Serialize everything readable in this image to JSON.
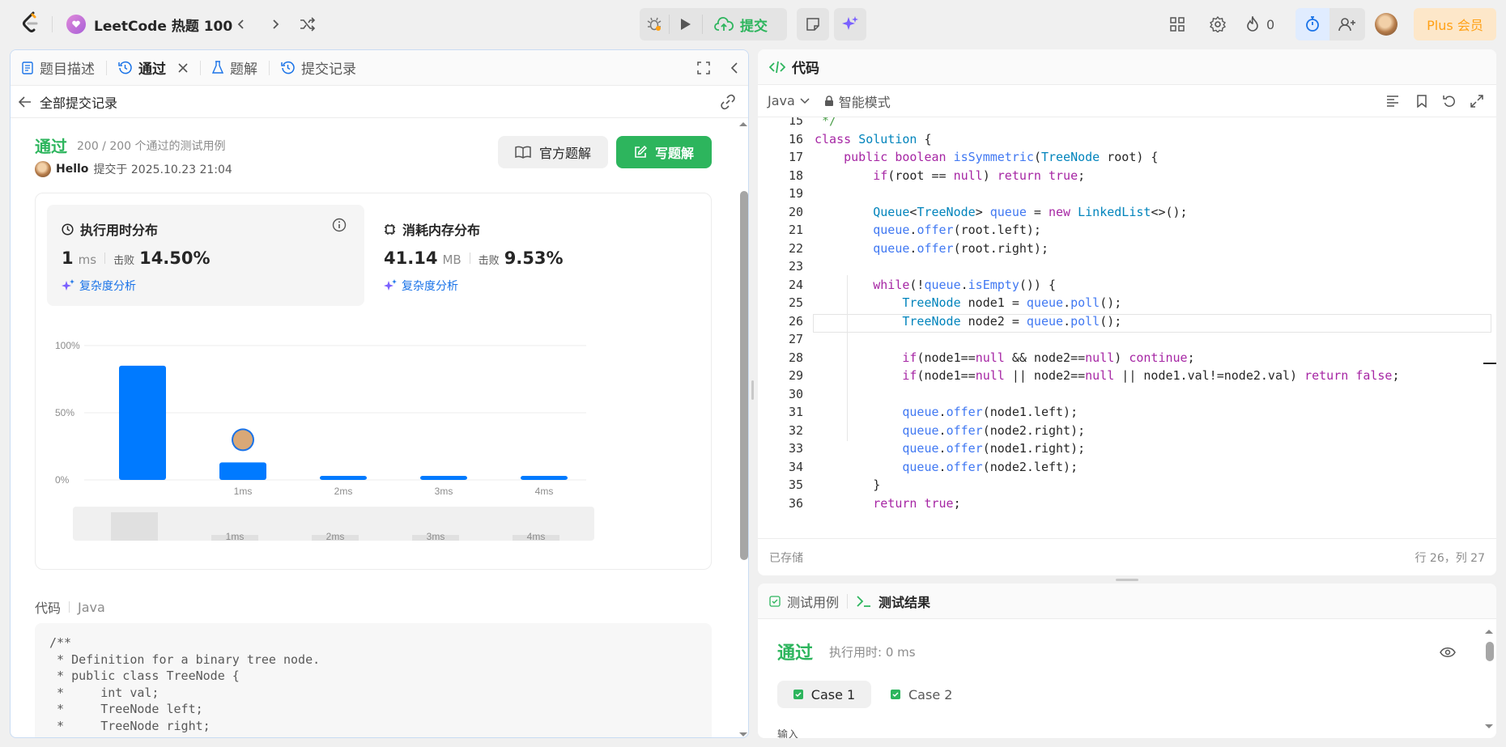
{
  "topbar": {
    "list_title": "LeetCode 热题 100",
    "submit_label": "提交",
    "streak_count": "0",
    "plus_label": "Plus 会员"
  },
  "left": {
    "tabs": [
      {
        "label": "题目描述"
      },
      {
        "label": "通过"
      },
      {
        "label": "题解"
      },
      {
        "label": "提交记录"
      }
    ],
    "back_label": "全部提交记录",
    "status": "通过",
    "testcases": "200 / 200 个通过的测试用例",
    "user": "Hello",
    "submitted_at": "提交于 2025.10.23 21:04",
    "official_btn": "官方题解",
    "write_btn": "写题解",
    "runtime": {
      "title": "执行用时分布",
      "value": "1",
      "unit": "ms",
      "beats_label": "击败",
      "beats": "14.50%",
      "analysis": "复杂度分析"
    },
    "memory": {
      "title": "消耗内存分布",
      "value": "41.14",
      "unit": "MB",
      "beats_label": "击败",
      "beats": "9.53%",
      "analysis": "复杂度分析"
    },
    "code_label": "代码",
    "code_lang": "Java",
    "code_preview": [
      "/**",
      " * Definition for a binary tree node.",
      " * public class TreeNode {",
      " *     int val;",
      " *     TreeNode left;",
      " *     TreeNode right;"
    ]
  },
  "chart_data": {
    "type": "bar",
    "categories": [
      "",
      "1ms",
      "2ms",
      "3ms",
      "4ms"
    ],
    "values": [
      85,
      13,
      3,
      3,
      3
    ],
    "yticks": [
      "100%",
      "50%",
      "0%"
    ],
    "ylim": [
      0,
      100
    ],
    "colors": {
      "bar": "#007aff"
    },
    "minimap_labels": [
      "1ms",
      "2ms",
      "3ms",
      "4ms"
    ]
  },
  "editor": {
    "title": "代码",
    "language": "Java",
    "mode": "智能模式",
    "saved": "已存储",
    "cursor": "行 26，列 27",
    "lines": [
      {
        "n": "15",
        "t": " */"
      },
      {
        "n": "16",
        "t": "class Solution {"
      },
      {
        "n": "17",
        "t": "    public boolean isSymmetric(TreeNode root) {"
      },
      {
        "n": "18",
        "t": "        if(root == null) return true;"
      },
      {
        "n": "19",
        "t": ""
      },
      {
        "n": "20",
        "t": "        Queue<TreeNode> queue = new LinkedList<>();"
      },
      {
        "n": "21",
        "t": "        queue.offer(root.left);"
      },
      {
        "n": "22",
        "t": "        queue.offer(root.right);"
      },
      {
        "n": "23",
        "t": ""
      },
      {
        "n": "24",
        "t": "        while(!queue.isEmpty()) {"
      },
      {
        "n": "25",
        "t": "            TreeNode node1 = queue.poll();"
      },
      {
        "n": "26",
        "t": "            TreeNode node2 = queue.poll();"
      },
      {
        "n": "27",
        "t": ""
      },
      {
        "n": "28",
        "t": "            if(node1==null && node2==null) continue;"
      },
      {
        "n": "29",
        "t": "            if(node1==null || node2==null || node1.val!=node2.val) return false;"
      },
      {
        "n": "30",
        "t": ""
      },
      {
        "n": "31",
        "t": "            queue.offer(node1.left);"
      },
      {
        "n": "32",
        "t": "            queue.offer(node2.right);"
      },
      {
        "n": "33",
        "t": "            queue.offer(node1.right);"
      },
      {
        "n": "34",
        "t": "            queue.offer(node2.left);"
      },
      {
        "n": "35",
        "t": "        }"
      },
      {
        "n": "36",
        "t": "        return true;"
      }
    ]
  },
  "results": {
    "tab_testcase": "测试用例",
    "tab_result": "测试结果",
    "status": "通过",
    "runtime": "执行用时: 0 ms",
    "cases": [
      "Case 1",
      "Case 2"
    ],
    "input_label": "输入"
  }
}
